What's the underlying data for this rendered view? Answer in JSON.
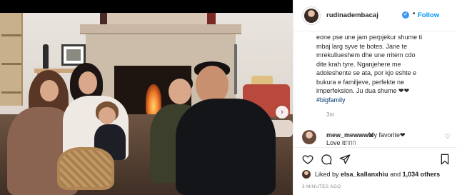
{
  "header": {
    "username": "rudinadembacaj",
    "verified_symbol": "✓",
    "separator": "•",
    "follow_label": "Follow"
  },
  "caption": {
    "lines": [
      "eone pse une jam perpjekur shume ti",
      "mbaj larg syve te botes. Jane te",
      "mrekullueshem dhe une rritem cdo",
      "dite krah tyre. Nganjehere me",
      "adoleshente se ata, por kjo eshte e",
      "bukura e familjeve, perfekte ne",
      "imperfeksion. Ju dua shume ❤❤"
    ],
    "hashtag": "#bigfamily",
    "time": "3m"
  },
  "comment": {
    "username": "mew_mewwww",
    "text": "My favorite❤",
    "text2": "Love it▯▯▯",
    "like_icon": "♡"
  },
  "actions": {
    "icons": [
      "heart-icon",
      "comment-icon",
      "share-icon",
      "save-icon"
    ]
  },
  "likes": {
    "prefix": "Liked by ",
    "user": "elsa_kallanxhiu",
    "middle": " and ",
    "others": "1,034 others"
  },
  "timestamp": "3 MINUTES AGO",
  "carousel": {
    "next_symbol": "›"
  },
  "colors": {
    "accent": "#0095f6",
    "verified": "#3897f0",
    "hashtag": "#00376b",
    "muted": "#8e8e8e"
  }
}
